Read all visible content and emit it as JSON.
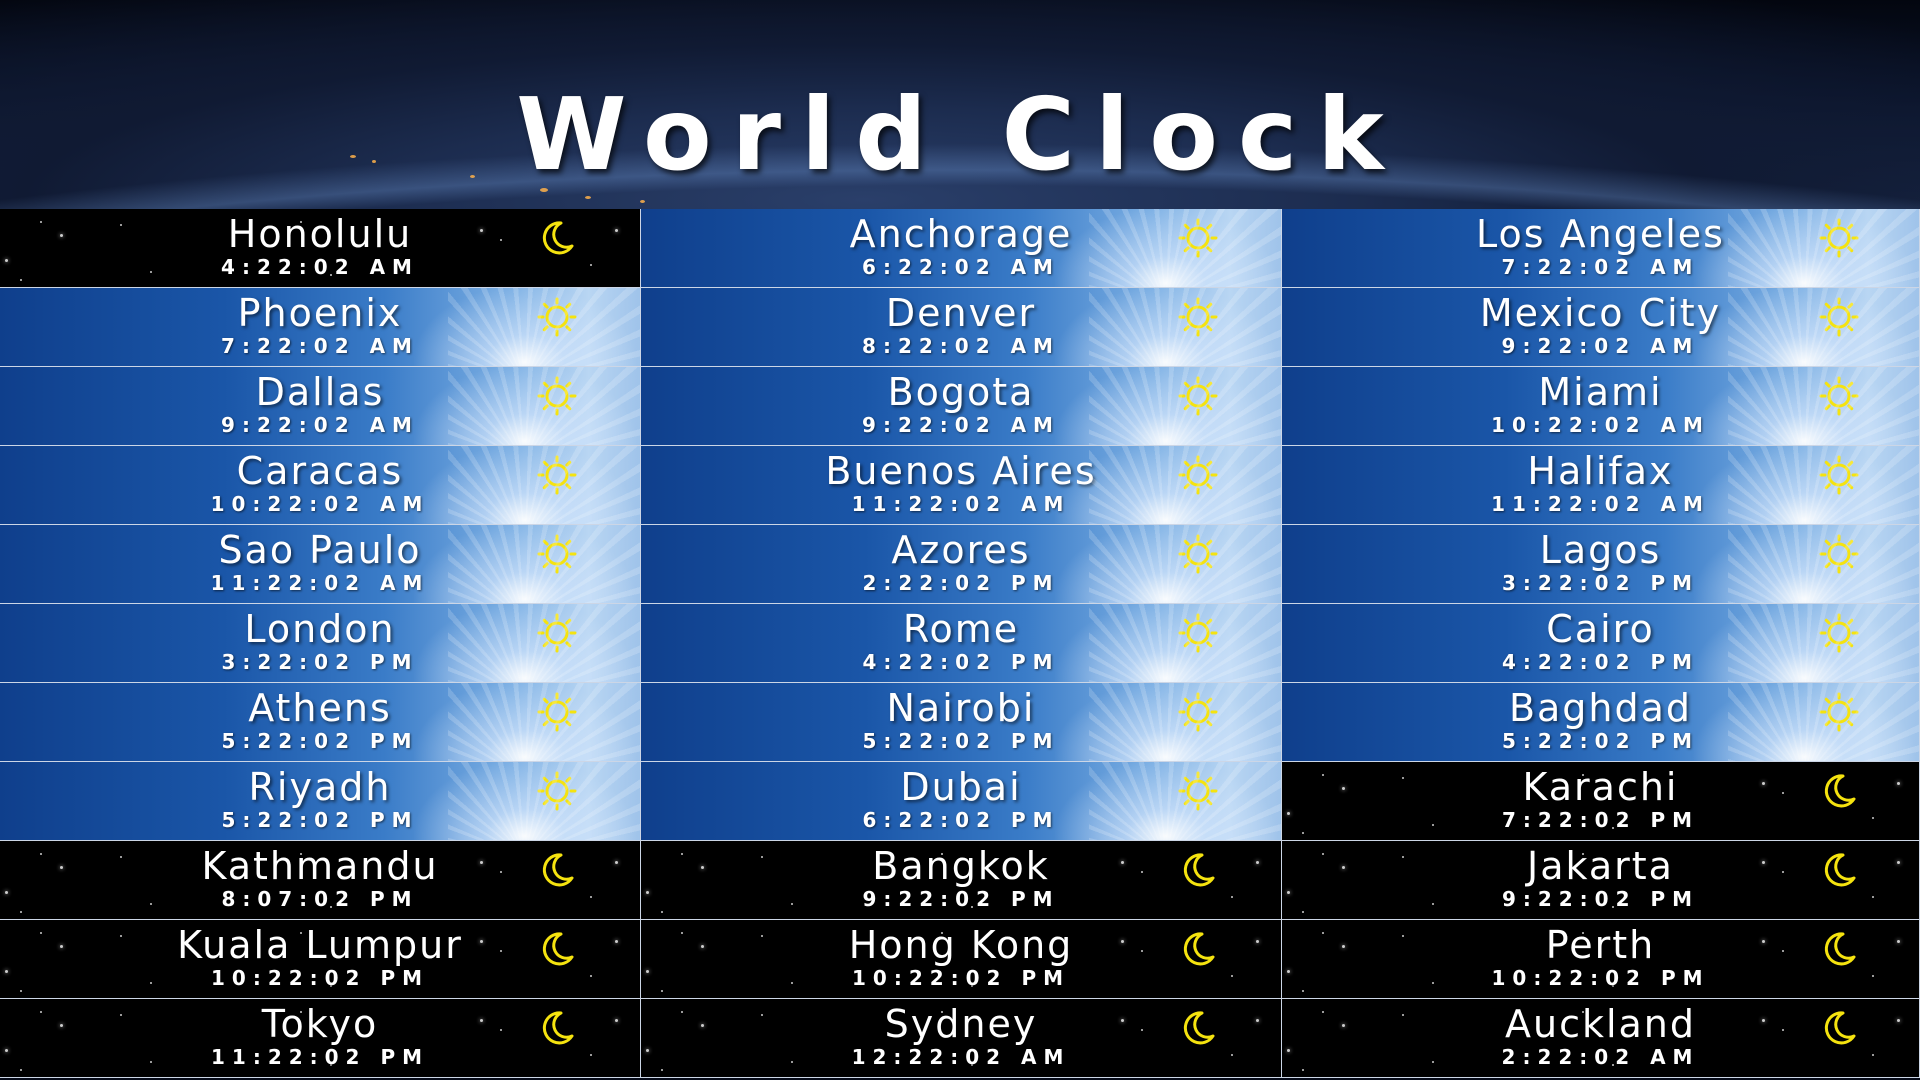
{
  "title": "World Clock",
  "colors": {
    "icon_yellow": "#f5e30f",
    "day_blue": "#1a56a8",
    "night": "#000000"
  },
  "icons": {
    "day": "sun-icon",
    "night": "moon-icon"
  },
  "clocks": [
    {
      "city": "Honolulu",
      "time": "4:22:02 AM",
      "mode": "night"
    },
    {
      "city": "Anchorage",
      "time": "6:22:02 AM",
      "mode": "day"
    },
    {
      "city": "Los Angeles",
      "time": "7:22:02 AM",
      "mode": "day"
    },
    {
      "city": "Phoenix",
      "time": "7:22:02 AM",
      "mode": "day"
    },
    {
      "city": "Denver",
      "time": "8:22:02 AM",
      "mode": "day"
    },
    {
      "city": "Mexico City",
      "time": "9:22:02 AM",
      "mode": "day"
    },
    {
      "city": "Dallas",
      "time": "9:22:02 AM",
      "mode": "day"
    },
    {
      "city": "Bogota",
      "time": "9:22:02 AM",
      "mode": "day"
    },
    {
      "city": "Miami",
      "time": "10:22:02 AM",
      "mode": "day"
    },
    {
      "city": "Caracas",
      "time": "10:22:02 AM",
      "mode": "day"
    },
    {
      "city": "Buenos Aires",
      "time": "11:22:02 AM",
      "mode": "day"
    },
    {
      "city": "Halifax",
      "time": "11:22:02 AM",
      "mode": "day"
    },
    {
      "city": "Sao Paulo",
      "time": "11:22:02 AM",
      "mode": "day"
    },
    {
      "city": "Azores",
      "time": "2:22:02 PM",
      "mode": "day"
    },
    {
      "city": "Lagos",
      "time": "3:22:02 PM",
      "mode": "day"
    },
    {
      "city": "London",
      "time": "3:22:02 PM",
      "mode": "day"
    },
    {
      "city": "Rome",
      "time": "4:22:02 PM",
      "mode": "day"
    },
    {
      "city": "Cairo",
      "time": "4:22:02 PM",
      "mode": "day"
    },
    {
      "city": "Athens",
      "time": "5:22:02 PM",
      "mode": "day"
    },
    {
      "city": "Nairobi",
      "time": "5:22:02 PM",
      "mode": "day"
    },
    {
      "city": "Baghdad",
      "time": "5:22:02 PM",
      "mode": "day"
    },
    {
      "city": "Riyadh",
      "time": "5:22:02 PM",
      "mode": "day"
    },
    {
      "city": "Dubai",
      "time": "6:22:02 PM",
      "mode": "day"
    },
    {
      "city": "Karachi",
      "time": "7:22:02 PM",
      "mode": "night"
    },
    {
      "city": "Kathmandu",
      "time": "8:07:02 PM",
      "mode": "night"
    },
    {
      "city": "Bangkok",
      "time": "9:22:02 PM",
      "mode": "night"
    },
    {
      "city": "Jakarta",
      "time": "9:22:02 PM",
      "mode": "night"
    },
    {
      "city": "Kuala Lumpur",
      "time": "10:22:02 PM",
      "mode": "night"
    },
    {
      "city": "Hong Kong",
      "time": "10:22:02 PM",
      "mode": "night"
    },
    {
      "city": "Perth",
      "time": "10:22:02 PM",
      "mode": "night"
    },
    {
      "city": "Tokyo",
      "time": "11:22:02 PM",
      "mode": "night"
    },
    {
      "city": "Sydney",
      "time": "12:22:02 AM",
      "mode": "night"
    },
    {
      "city": "Auckland",
      "time": "2:22:02 AM",
      "mode": "night"
    }
  ]
}
